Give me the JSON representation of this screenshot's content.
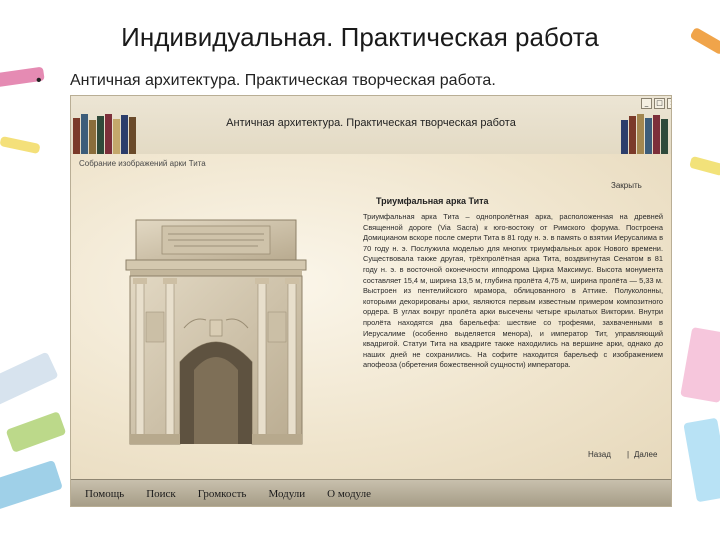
{
  "slide": {
    "title": "Индивидуальная. Практическая работа",
    "bullet_mark": "•",
    "bullet_text": "Античная архитектура. Практическая творческая работа."
  },
  "app": {
    "title": "Античная архитектура. Практическая творческая работа",
    "window_buttons": [
      "_",
      "□",
      "×"
    ],
    "breadcrumb": "Собрание изображений арки Тита",
    "back_to_list": "Закрыть",
    "article": {
      "title": "Триумфальная арка Тита",
      "body": "Триумфальная арка Тита – однопролётная арка, расположенная на древней Священной дороге (Via Sacra) к юго-востоку от Римского форума. Построена Домицианом вскоре после смерти Тита в 81 году н. э. в память о взятии Иерусалима в 70 году н. э. Послужила моделью для многих триумфальных арок Нового времени. Существовала также другая, трёхпролётная арка Тита, воздвигнутая Сенатом в 81 году н. э. в восточной оконечности ипподрома Цирка Максимус. Высота монумента составляет 15,4 м, ширина 13,5 м, глубина пролёта 4,75 м, ширина пролёта — 5,33 м. Выстроен из пентелийского мрамора, облицованного в Аттике. Полуколонны, которыми декорированы арки, являются первым известным примером композитного ордера. В углах вокруг пролёта арки высечены четыре крылатых Виктории. Внутри пролёта находятся два барельефа: шествие со трофеями, захваченными в Иерусалиме (особенно выделяется менора), и император Тит, управляющий квадригой. Статуи Тита на квадриге также находились на вершине арки, однако до наших дней не сохранились. На софите находится барельеф с изображением апофеоза (обретения божественной сущности) императора."
    },
    "nav": {
      "back": "Назад",
      "separator": "|",
      "next": "Далее"
    },
    "menu": [
      "Помощь",
      "Поиск",
      "Громкость",
      "Модули",
      "О модуле"
    ]
  },
  "colors": {
    "app_background": "#f1ead9",
    "menubar": "#b4ac97",
    "stone": "#d8cdb7"
  }
}
